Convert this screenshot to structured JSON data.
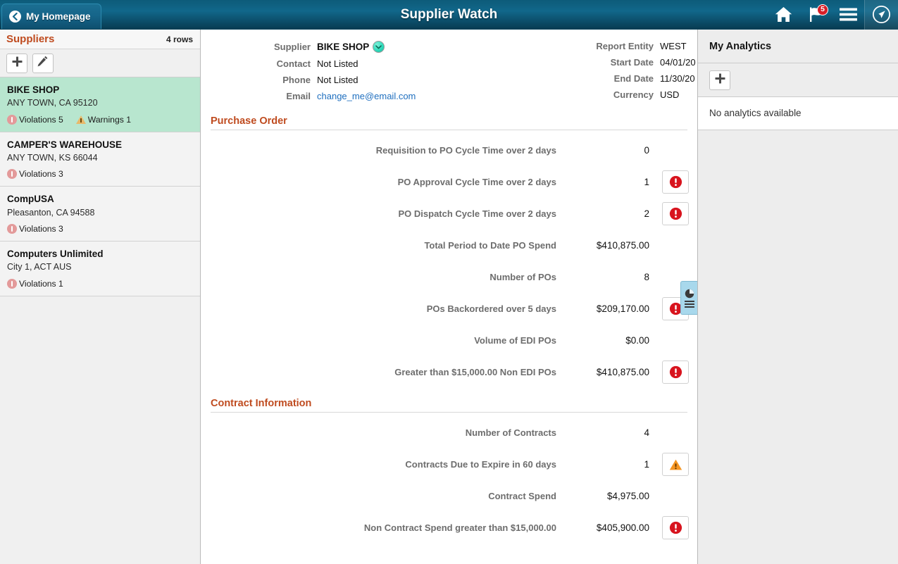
{
  "header": {
    "back_label": "My Homepage",
    "title": "Supplier Watch",
    "icons": {
      "home": "home-icon",
      "flag": "flag-icon",
      "menu": "hamburger-menu-icon",
      "nav": "nav-compass-icon"
    },
    "notification_badge": "5"
  },
  "sidebar": {
    "title": "Suppliers",
    "row_count": "4 rows",
    "toolbar": {
      "add_label": "add-icon",
      "edit_label": "edit-pencil-icon"
    },
    "items": [
      {
        "name": "BIKE SHOP",
        "location": "ANY TOWN, CA  95120",
        "violations": "Violations 5",
        "warnings": "Warnings 1",
        "selected": true
      },
      {
        "name": "CAMPER'S WAREHOUSE",
        "location": "ANY TOWN, KS  66044",
        "violations": "Violations 3",
        "warnings": "",
        "selected": false
      },
      {
        "name": "CompUSA",
        "location": "Pleasanton, CA  94588",
        "violations": "Violations 3",
        "warnings": "",
        "selected": false
      },
      {
        "name": "Computers Unlimited",
        "location": "City 1, ACT  AUS",
        "violations": "Violations 1",
        "warnings": "",
        "selected": false
      }
    ]
  },
  "detail": {
    "left": [
      {
        "label": "Supplier",
        "value": "BIKE SHOP",
        "style": "bold",
        "dropdown": true
      },
      {
        "label": "Contact",
        "value": "Not Listed",
        "style": "plain",
        "dropdown": false
      },
      {
        "label": "Phone",
        "value": "Not Listed",
        "style": "plain",
        "dropdown": false
      },
      {
        "label": "Email",
        "value": "change_me@email.com",
        "style": "link",
        "dropdown": false
      }
    ],
    "right": [
      {
        "label": "Report Entity",
        "value": "WEST"
      },
      {
        "label": "Start Date",
        "value": "04/01/20"
      },
      {
        "label": "End Date",
        "value": "11/30/20"
      },
      {
        "label": "Currency",
        "value": "USD"
      }
    ]
  },
  "sections": [
    {
      "title": "Purchase Order",
      "metrics": [
        {
          "label": "Requisition to PO Cycle Time over 2 days",
          "value": "0",
          "alert": "none"
        },
        {
          "label": "PO Approval Cycle Time over 2 days",
          "value": "1",
          "alert": "violation"
        },
        {
          "label": "PO Dispatch Cycle Time over 2 days",
          "value": "2",
          "alert": "violation"
        },
        {
          "label": "Total Period to Date PO Spend",
          "value": "$410,875.00",
          "alert": "none"
        },
        {
          "label": "Number of POs",
          "value": "8",
          "alert": "none"
        },
        {
          "label": "POs Backordered over 5 days",
          "value": "$209,170.00",
          "alert": "violation"
        },
        {
          "label": "Volume of EDI POs",
          "value": "$0.00",
          "alert": "none"
        },
        {
          "label": "Greater than $15,000.00 Non EDI POs",
          "value": "$410,875.00",
          "alert": "violation"
        }
      ]
    },
    {
      "title": "Contract Information",
      "metrics": [
        {
          "label": "Number of Contracts",
          "value": "4",
          "alert": "none"
        },
        {
          "label": "Contracts Due to Expire in 60 days",
          "value": "1",
          "alert": "warning"
        },
        {
          "label": "Contract Spend",
          "value": "$4,975.00",
          "alert": "none"
        },
        {
          "label": "Non Contract Spend greater than $15,000.00",
          "value": "$405,900.00",
          "alert": "violation"
        }
      ]
    }
  ],
  "analytics_panel": {
    "title": "My Analytics",
    "add_label": "add-icon",
    "empty_message": "No analytics available"
  },
  "side_handle": {
    "name": "report-chart-handle"
  },
  "colors": {
    "header_gradient_top": "#11678a",
    "header_gradient_bottom": "#083c52",
    "accent_orange": "#bf4b1f",
    "selected_row": "#b8e6cf",
    "violation_red": "#d81f28",
    "warning_orange": "#f59522",
    "link_blue": "#1f6fbf",
    "badge_red": "#d81f28"
  }
}
